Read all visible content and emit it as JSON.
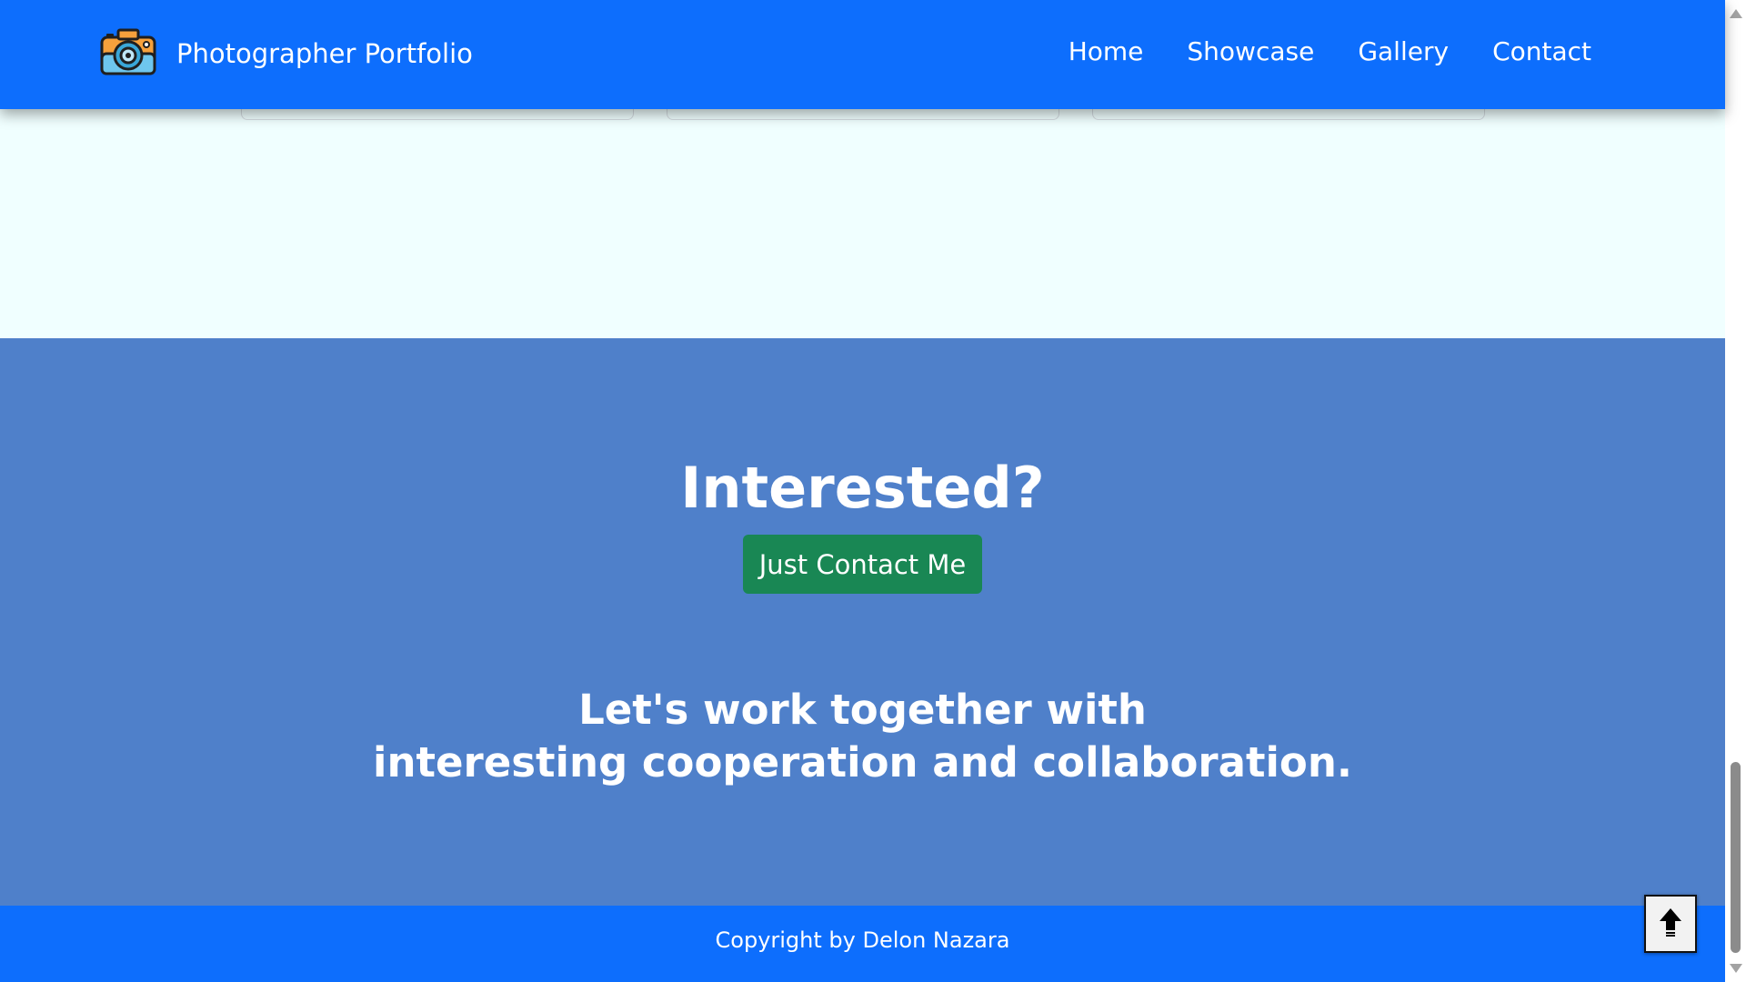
{
  "navbar": {
    "brand_title": "Photographer Portfolio",
    "brand_icon": "camera-icon",
    "links": [
      "Home",
      "Showcase",
      "Gallery",
      "Contact"
    ]
  },
  "cta": {
    "title": "Interested?",
    "button_label": "Just Contact Me",
    "text_line1": "Let's work together with",
    "text_line2": "interesting cooperation and collaboration."
  },
  "footer": {
    "copyright": "Copyright by Delon Nazara"
  },
  "back_to_top": {
    "icon": "arrow-up-icon"
  },
  "colors": {
    "navbar": "#0d6efd",
    "cta_section": "#4f80ca",
    "cta_button": "#198754",
    "page_background": "#f0ffff"
  }
}
